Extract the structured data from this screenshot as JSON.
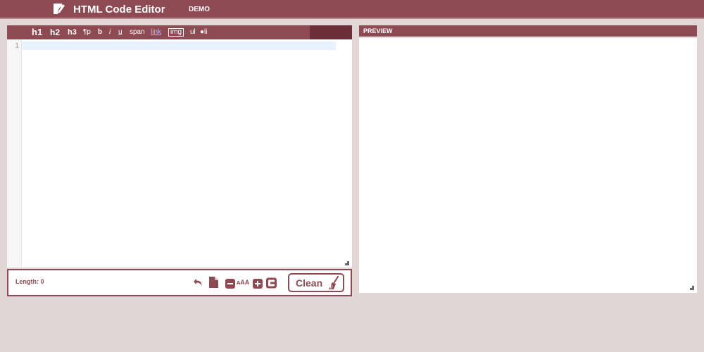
{
  "header": {
    "title": "HTML Code Editor",
    "nav_demo": "DEMO",
    "logo_icon": "edit-document-icon"
  },
  "toolbar": {
    "items": [
      "h1",
      "h2",
      "h3",
      "¶p",
      "b",
      "i",
      "u",
      "span",
      "link",
      "img",
      "ul",
      "●li"
    ]
  },
  "editor": {
    "line_numbers": [
      "1"
    ],
    "content": ""
  },
  "status": {
    "length_label": "Length: 0",
    "icons": [
      "undo-icon",
      "new-document-icon",
      "decrease-font-icon",
      "font-size-icon",
      "increase-font-icon",
      "wrap-icon"
    ],
    "font_size_text": "ᴀAA",
    "clean_label": "Clean"
  },
  "preview": {
    "title": "PREVIEW"
  },
  "colors": {
    "brand": "#8e4a53",
    "brand_dark": "#6a2f38",
    "background": "#e3d6d6",
    "link": "#b8b0ff",
    "active_line": "#e8f2fe"
  }
}
